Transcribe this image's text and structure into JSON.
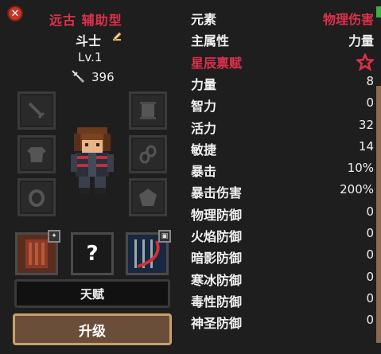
{
  "header": {
    "char_type": "远古 辅助型",
    "char_name": "斗士",
    "char_level": "Lv.1",
    "char_power": "396"
  },
  "equipment_slots": [
    {
      "slot": "weapon",
      "icon": "sword-icon"
    },
    {
      "slot": "book",
      "icon": "scroll-icon"
    },
    {
      "slot": "armor",
      "icon": "shirt-icon"
    },
    {
      "slot": "accessory",
      "icon": "chain-icon"
    },
    {
      "slot": "ring",
      "icon": "ring-icon"
    },
    {
      "slot": "gem",
      "icon": "gem-icon"
    }
  ],
  "skills": {
    "unknown_label": "?"
  },
  "buttons": {
    "talent": "天赋",
    "upgrade": "升级"
  },
  "stats": [
    {
      "label": "元素",
      "value": "物理伤害",
      "label_color": "#f0f0f0",
      "value_color": "#e0304a"
    },
    {
      "label": "主属性",
      "value": "力量",
      "label_color": "#f0f0f0",
      "value_color": "#f0f0f0"
    },
    {
      "label": "星辰禀赋",
      "value": "",
      "label_color": "#e0304a",
      "value_color": "#e0304a"
    },
    {
      "label": "力量",
      "value": "8"
    },
    {
      "label": "智力",
      "value": "0"
    },
    {
      "label": "活力",
      "value": "32"
    },
    {
      "label": "敏捷",
      "value": "14"
    },
    {
      "label": "暴击",
      "value": "10%"
    },
    {
      "label": "暴击伤害",
      "value": "200%"
    },
    {
      "label": "物理防御",
      "value": "0"
    },
    {
      "label": "火焰防御",
      "value": "0"
    },
    {
      "label": "暗影防御",
      "value": "0"
    },
    {
      "label": "寒冰防御",
      "value": "0"
    },
    {
      "label": "毒性防御",
      "value": "0"
    },
    {
      "label": "神圣防御",
      "value": "0"
    },
    {
      "label": "",
      "value": ""
    }
  ],
  "colors": {
    "accent_red": "#e0304a",
    "panel_bg": "#1e1e1e",
    "upgrade_border": "#c9a06a"
  }
}
